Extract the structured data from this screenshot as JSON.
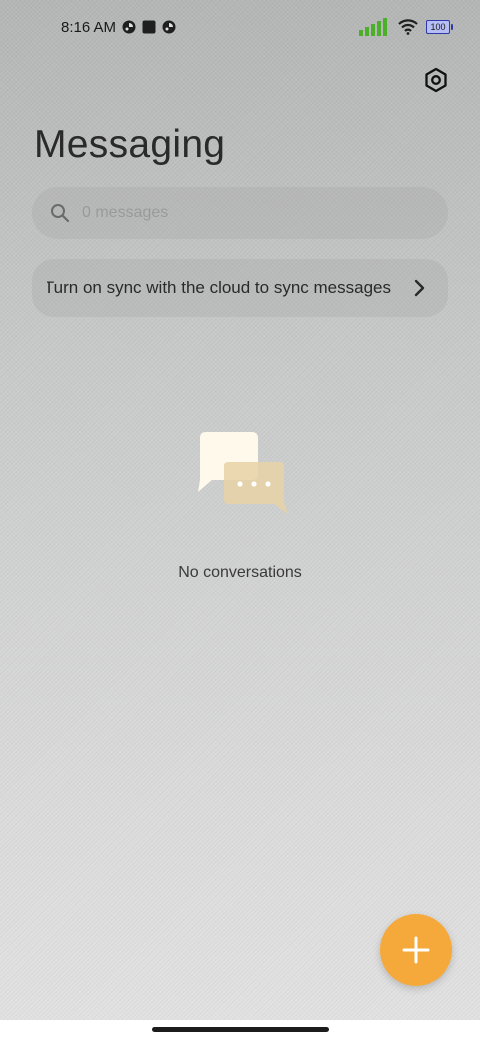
{
  "status_bar": {
    "time": "8:16 AM",
    "battery": "100",
    "icons": [
      "notification-icon",
      "stop-icon",
      "notification-icon",
      "signal-icon",
      "wifi-icon",
      "battery-icon"
    ]
  },
  "header": {
    "title": "Messaging",
    "settings_icon": "settings-hexagon-icon"
  },
  "search": {
    "placeholder": "0 messages",
    "value": ""
  },
  "sync_banner": {
    "label": "Turn on sync with the cloud to sync messages"
  },
  "empty_state": {
    "label": "No conversations"
  },
  "fab": {
    "icon": "plus-icon",
    "color": "#f5a93b"
  }
}
